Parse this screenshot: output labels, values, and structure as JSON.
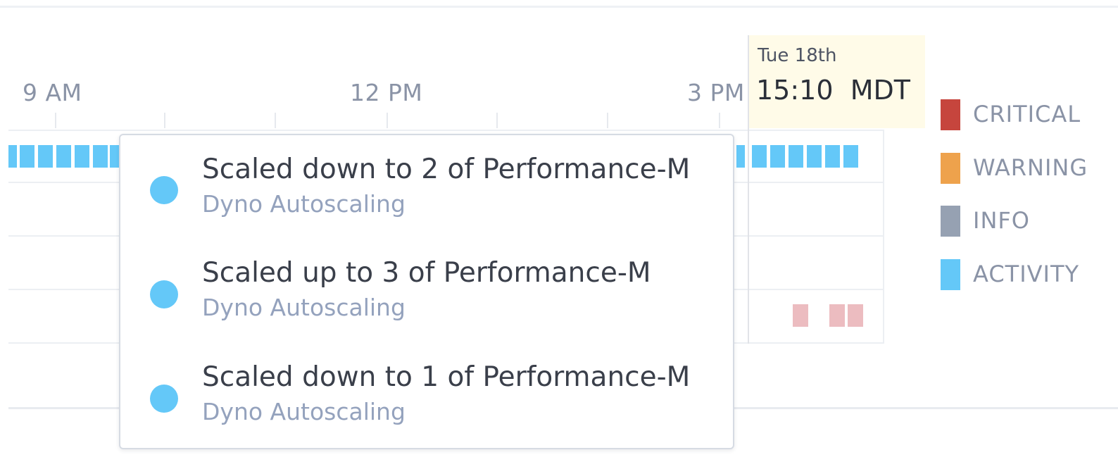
{
  "axis": {
    "labels": [
      "9 AM",
      "12 PM",
      "3 PM"
    ]
  },
  "tooltip": {
    "day": "Tue 18th",
    "time": "15:10",
    "tz": "MDT"
  },
  "legend": {
    "items": [
      {
        "label": "CRITICAL",
        "color": "#c6453d"
      },
      {
        "label": "WARNING",
        "color": "#eea24c"
      },
      {
        "label": "INFO",
        "color": "#96a1b2"
      },
      {
        "label": "ACTIVITY",
        "color": "#64c8f8"
      }
    ]
  },
  "popover": {
    "events": [
      {
        "title": "Scaled down to 2 of Performance-M",
        "source": "Dyno Autoscaling"
      },
      {
        "title": "Scaled up to 3 of Performance-M",
        "source": "Dyno Autoscaling"
      },
      {
        "title": "Scaled down to 1 of Performance-M",
        "source": "Dyno Autoscaling"
      }
    ]
  },
  "colors": {
    "activity": "#64c8f8",
    "critical_faded": "#ecbcc0",
    "tooltip_bg": "#fffbe8"
  }
}
